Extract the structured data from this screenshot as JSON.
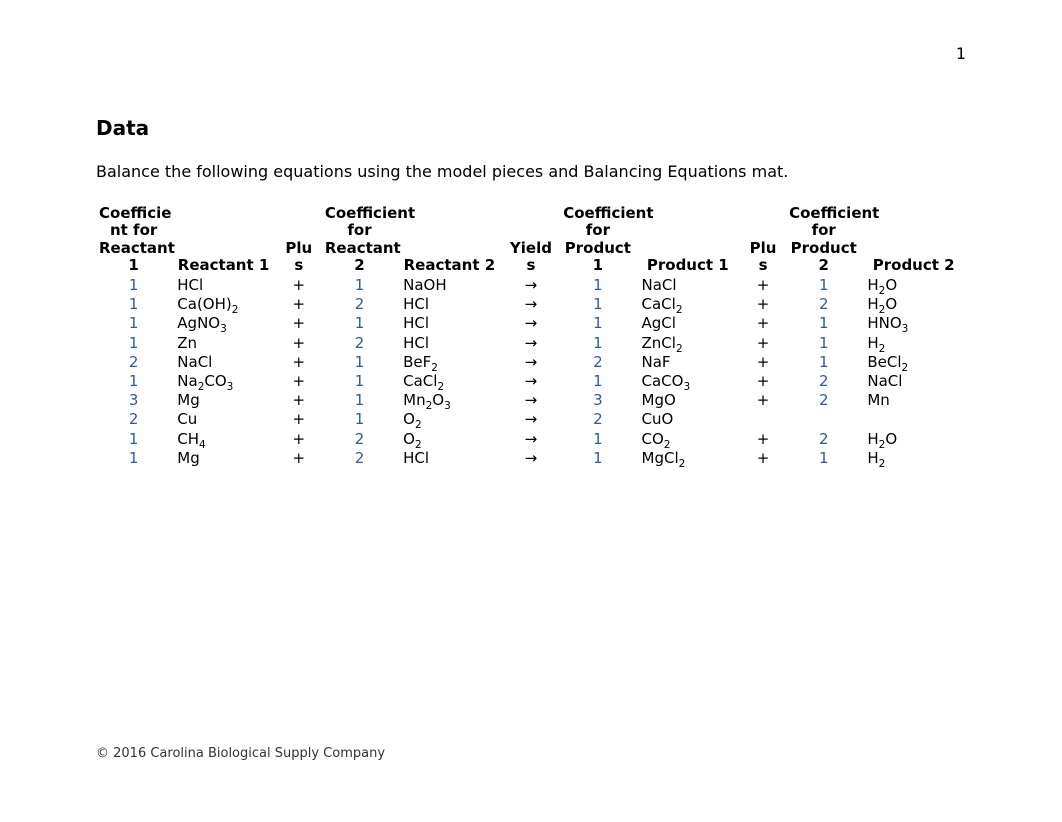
{
  "page_number": "1",
  "section_title": "Data",
  "instruction": "Balance the following equations using the model pieces and Balancing Equations mat.",
  "headers": {
    "coef_r1": "Coefficie\nnt for Reactant 1",
    "react1": "Reactant 1",
    "plus1": "Plu\ns",
    "coef_r2": "Coefficient for Reactant 2",
    "react2": "Reactant 2",
    "yields": "Yield\ns",
    "coef_p1": "Coefficient for Product 1",
    "prod1": "Product 1",
    "plus2": "Plu\ns",
    "coef_p2": "Coefficient for Product 2",
    "prod2": "Product 2"
  },
  "rows": [
    {
      "c_r1": "1",
      "r1": "HCl",
      "plus1": "+",
      "c_r2": "1",
      "r2": "NaOH",
      "y": "→",
      "c_p1": "1",
      "p1": "NaCl",
      "plus2": "+",
      "c_p2": "1",
      "p2": "H₂O"
    },
    {
      "c_r1": "1",
      "r1": "Ca(OH)₂",
      "plus1": "+",
      "c_r2": "2",
      "r2": "HCl",
      "y": "→",
      "c_p1": "1",
      "p1": "CaCl₂",
      "plus2": "+",
      "c_p2": "2",
      "p2": "H₂O"
    },
    {
      "c_r1": "1",
      "r1": "AgNO₃",
      "plus1": "+",
      "c_r2": "1",
      "r2": "HCl",
      "y": "→",
      "c_p1": "1",
      "p1": "AgCl",
      "plus2": "+",
      "c_p2": "1",
      "p2": "HNO₃"
    },
    {
      "c_r1": "1",
      "r1": "Zn",
      "plus1": "+",
      "c_r2": "2",
      "r2": "HCl",
      "y": "→",
      "c_p1": "1",
      "p1": "ZnCl₂",
      "plus2": "+",
      "c_p2": "1",
      "p2": "H₂"
    },
    {
      "c_r1": "2",
      "r1": "NaCl",
      "plus1": "+",
      "c_r2": "1",
      "r2": "BeF₂",
      "y": "→",
      "c_p1": "2",
      "p1": "NaF",
      "plus2": "+",
      "c_p2": "1",
      "p2": "BeCl₂"
    },
    {
      "c_r1": "1",
      "r1": "Na₂CO₃",
      "plus1": "+",
      "c_r2": "1",
      "r2": "CaCl₂",
      "y": "→",
      "c_p1": "1",
      "p1": "CaCO₃",
      "plus2": "+",
      "c_p2": "2",
      "p2": "NaCl"
    },
    {
      "c_r1": "3",
      "r1": "Mg",
      "plus1": "+",
      "c_r2": "1",
      "r2": "Mn₂O₃",
      "y": "→",
      "c_p1": "3",
      "p1": "MgO",
      "plus2": "+",
      "c_p2": "2",
      "p2": "Mn"
    },
    {
      "c_r1": "2",
      "r1": "Cu",
      "plus1": "+",
      "c_r2": "1",
      "r2": "O₂",
      "y": "→",
      "c_p1": "2",
      "p1": "CuO",
      "plus2": "",
      "c_p2": "",
      "p2": ""
    },
    {
      "c_r1": "1",
      "r1": "CH₄",
      "plus1": "+",
      "c_r2": "2",
      "r2": "O₂",
      "y": "→",
      "c_p1": "1",
      "p1": "CO₂",
      "plus2": "+",
      "c_p2": "2",
      "p2": "H₂O"
    },
    {
      "c_r1": "1",
      "r1": "Mg",
      "plus1": "+",
      "c_r2": "2",
      "r2": "HCl",
      "y": "→",
      "c_p1": "1",
      "p1": "MgCl₂",
      "plus2": "+",
      "c_p2": "1",
      "p2": "H₂"
    }
  ],
  "footer": "© 2016 Carolina Biological Supply Company"
}
